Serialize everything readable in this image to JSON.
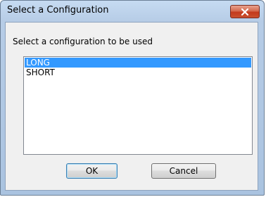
{
  "window": {
    "title": "Select a Configuration"
  },
  "dialog": {
    "prompt": "Select a configuration to be used",
    "options": [
      {
        "label": "LONG",
        "selected": true
      },
      {
        "label": "SHORT",
        "selected": false
      }
    ],
    "ok_label": "OK",
    "cancel_label": "Cancel"
  },
  "icons": {
    "close": "close-icon"
  },
  "colors": {
    "selection": "#3399ff",
    "close_button": "#c9502f",
    "titlebar": "#b6cce6"
  }
}
